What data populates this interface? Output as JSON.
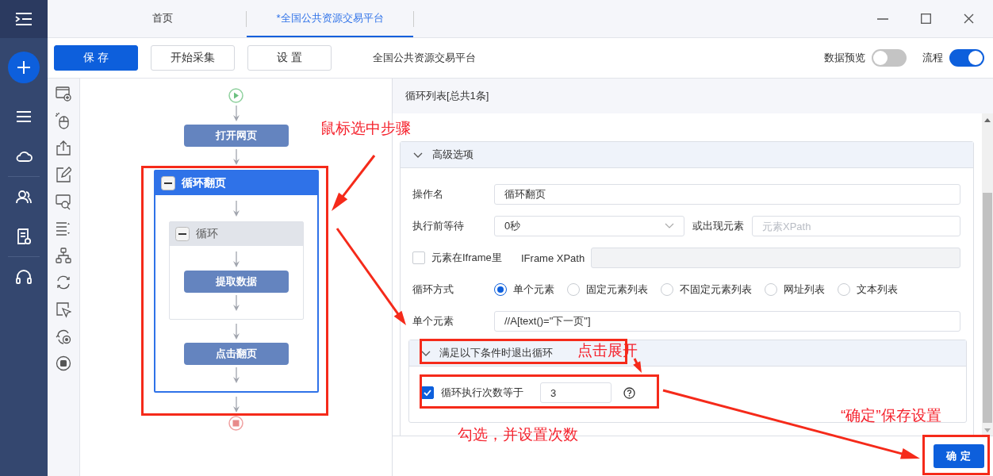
{
  "tabs": [
    {
      "label": "首页",
      "selected": false
    },
    {
      "label": "*全国公共资源交易平台",
      "selected": true
    }
  ],
  "toolbar": {
    "buttons": [
      {
        "label": "保 存",
        "kind": "primary"
      },
      {
        "label": "开始采集",
        "kind": "default"
      },
      {
        "label": "设 置",
        "kind": "default"
      }
    ],
    "task_name": "全国公共资源交易平台",
    "toggles": [
      {
        "label": "数据预览",
        "on": false
      },
      {
        "label": "流程",
        "on": true
      }
    ]
  },
  "flow": {
    "steps": [
      {
        "kind": "step",
        "label": "打开网页"
      },
      {
        "kind": "loop",
        "label": "循环翻页",
        "selected": true,
        "children": [
          {
            "kind": "loop",
            "label": "循环",
            "selected": false,
            "children": [
              {
                "kind": "step",
                "label": "提取数据"
              }
            ]
          },
          {
            "kind": "step",
            "label": "点击翻页"
          }
        ]
      }
    ]
  },
  "panel": {
    "title": "循环列表[总共1条]",
    "section": {
      "title": "高级选项",
      "expanded": true,
      "operation_name": {
        "label": "操作名",
        "value": "循环翻页"
      },
      "wait": {
        "label": "执行前等待",
        "value": "0秒",
        "or_label": "或出现元素",
        "xpath_placeholder": "元素XPath"
      },
      "iframe": {
        "label": "元素在Iframe里",
        "checked": false,
        "xpath_label": "IFrame XPath"
      },
      "loop_mode": {
        "label": "循环方式",
        "options": [
          {
            "label": "单个元素",
            "selected": true
          },
          {
            "label": "固定元素列表",
            "selected": false
          },
          {
            "label": "不固定元素列表",
            "selected": false
          },
          {
            "label": "网址列表",
            "selected": false
          },
          {
            "label": "文本列表",
            "selected": false
          }
        ]
      },
      "single_element": {
        "label": "单个元素",
        "value": "//A[text()=\"下一页\"]"
      },
      "exit_conditions": {
        "title": "满足以下条件时退出循环",
        "expanded": true,
        "conditions": [
          {
            "label": "循环执行次数等于",
            "checked": true,
            "value": "3"
          }
        ]
      }
    },
    "confirm_button": "确 定"
  },
  "annotations": [
    {
      "text": "鼠标选中步骤"
    },
    {
      "text": "点击展开"
    },
    {
      "text": "勾选，并设置次数"
    },
    {
      "text": "“确定”保存设置"
    }
  ]
}
